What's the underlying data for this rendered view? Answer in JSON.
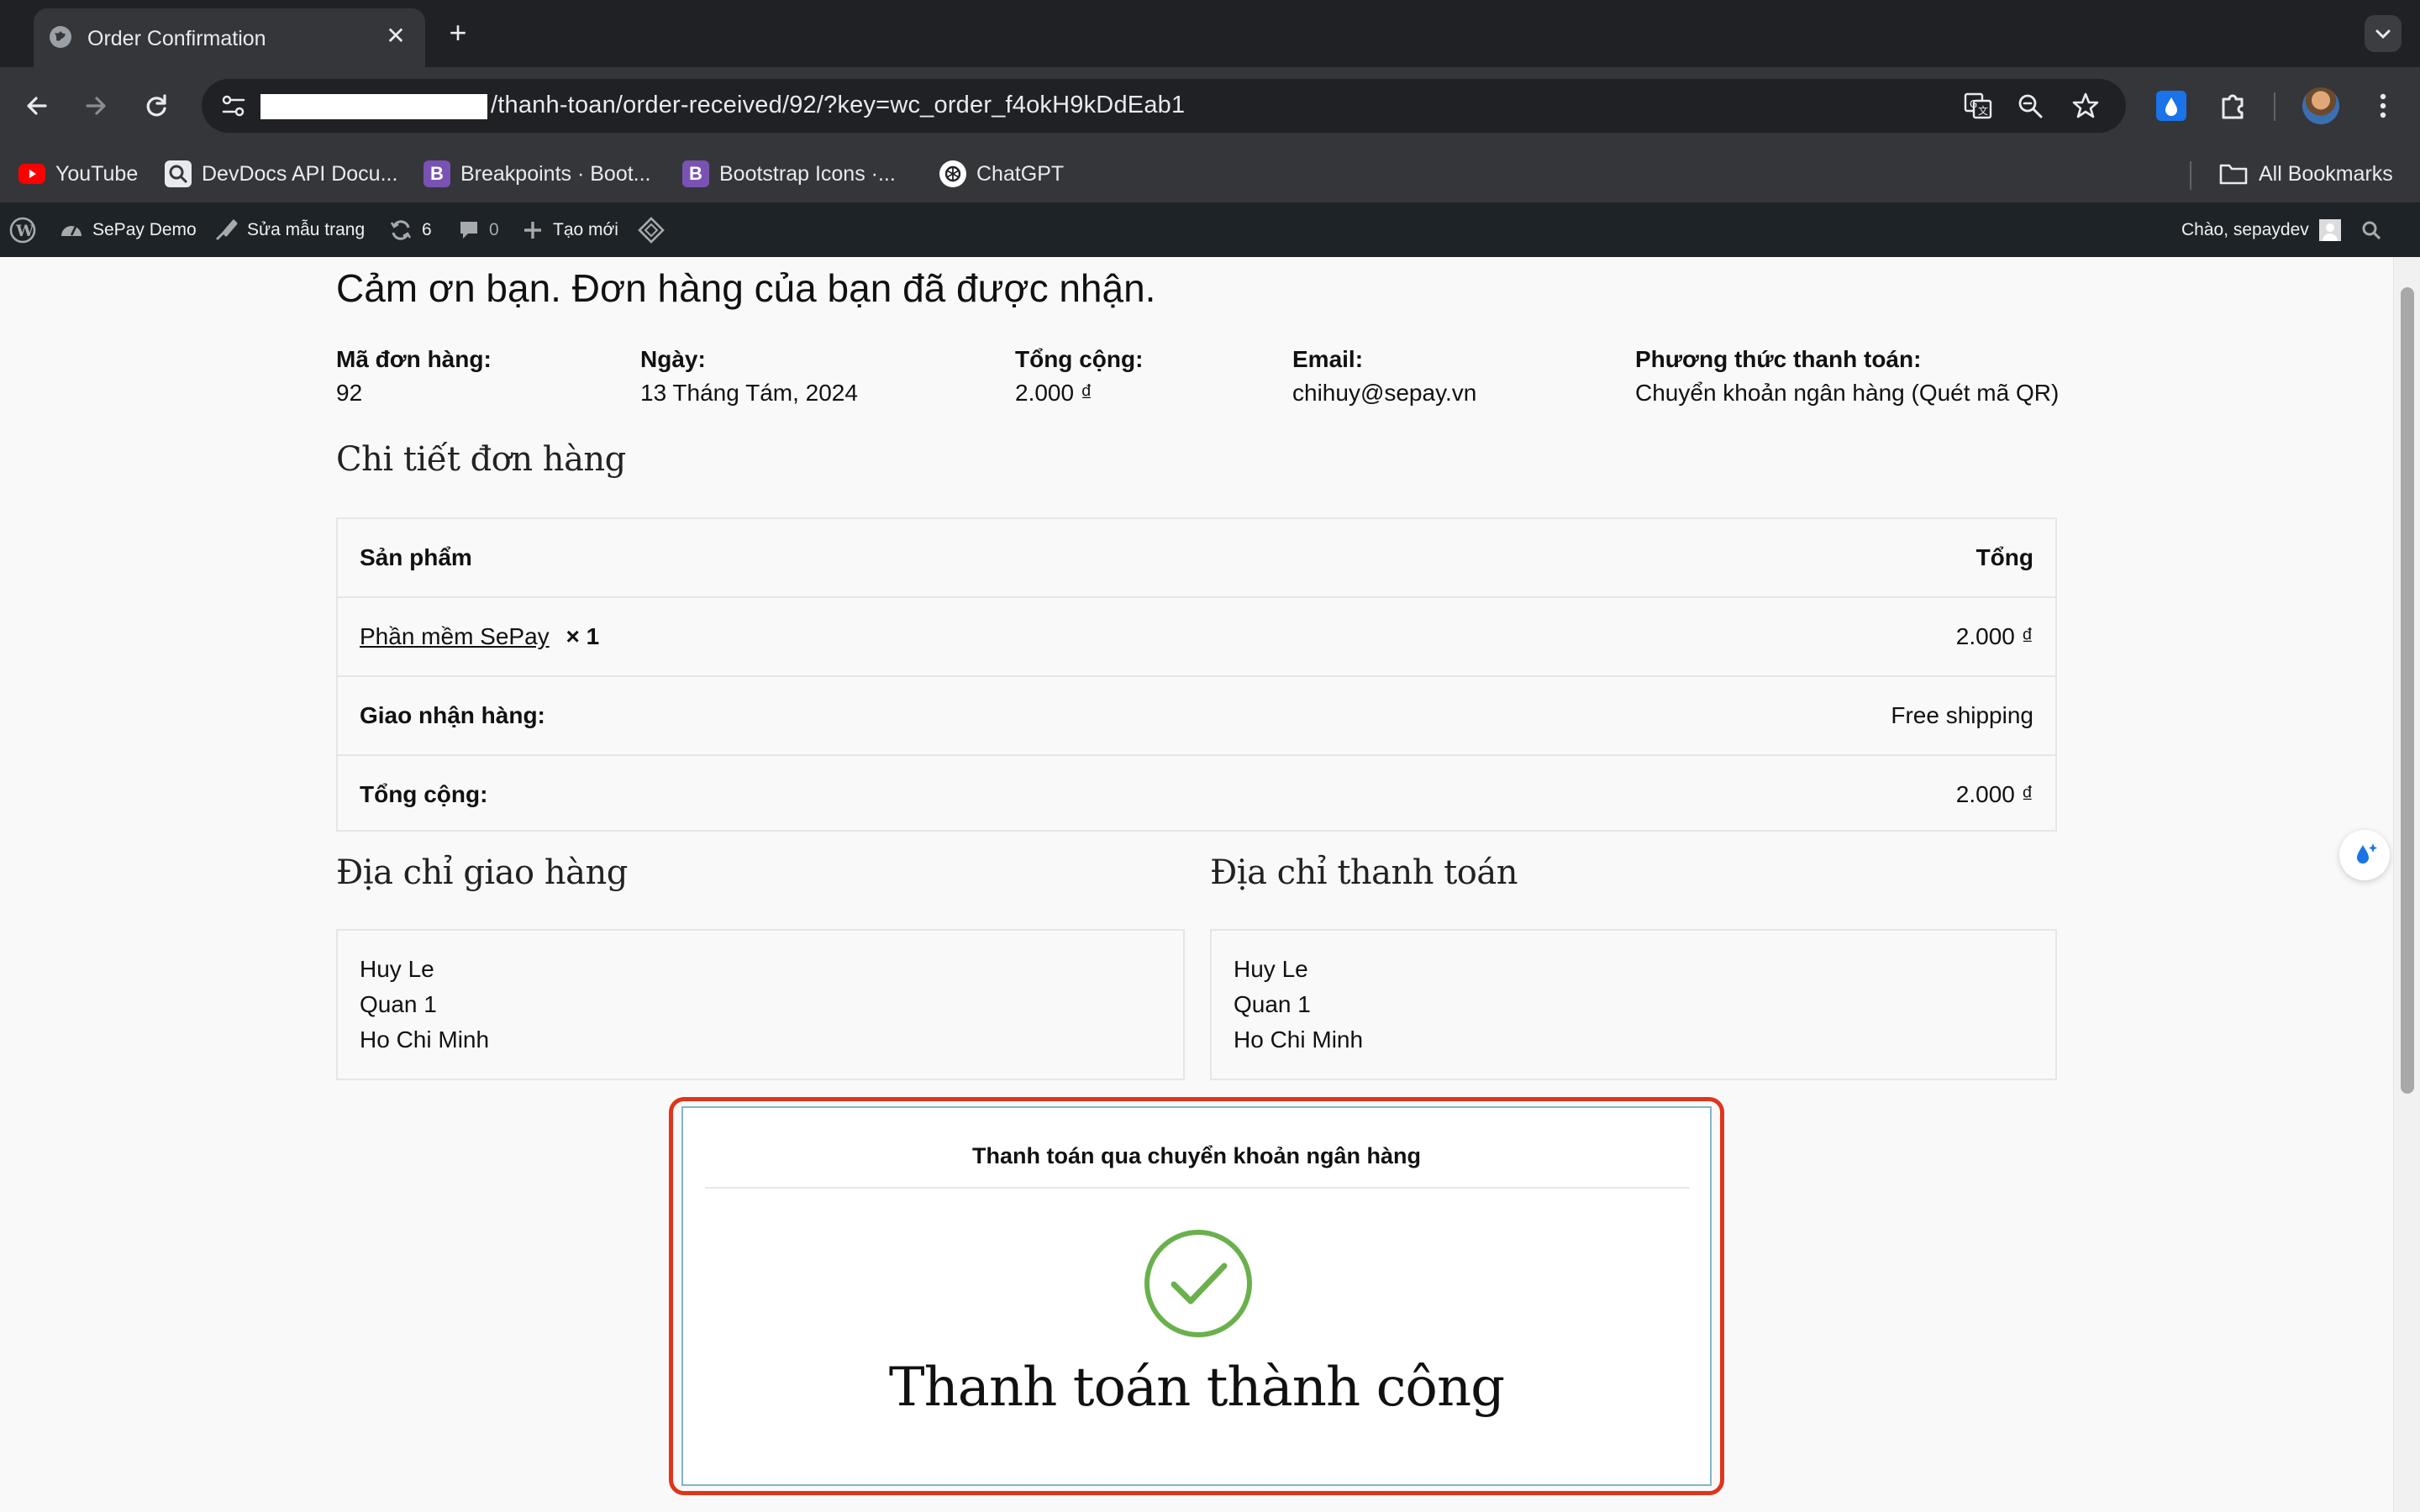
{
  "browser": {
    "tab_title": "Order Confirmation",
    "url_path": "/thanh-toan/order-received/92/?key=wc_order_f4okH9kDdEab1",
    "bookmarks": [
      {
        "label": "YouTube",
        "icon": "youtube-icon"
      },
      {
        "label": "DevDocs API Docu...",
        "icon": "devdocs-icon"
      },
      {
        "label": "Breakpoints · Boot...",
        "icon": "bootstrap-icon"
      },
      {
        "label": "Bootstrap Icons ·...",
        "icon": "bootstrap-icon"
      },
      {
        "label": "ChatGPT",
        "icon": "chatgpt-icon"
      }
    ],
    "all_bookmarks": "All Bookmarks"
  },
  "wpbar": {
    "site_name": "SePay Demo",
    "edit_template": "Sửa mẫu trang",
    "updates_count": "6",
    "comments_count": "0",
    "new_label": "Tạo mới",
    "greeting": "Chào, sepaydev"
  },
  "page": {
    "thanks": "Cảm ơn bạn. Đơn hàng của bạn đã được nhận.",
    "overview": [
      {
        "label": "Mã đơn hàng:",
        "value": "92"
      },
      {
        "label": "Ngày:",
        "value": "13 Tháng Tám, 2024"
      },
      {
        "label": "Tổng cộng:",
        "value": "2.000 ₫"
      },
      {
        "label": "Email:",
        "value": "chihuy@sepay.vn"
      },
      {
        "label": "Phương thức thanh toán:",
        "value": "Chuyển khoản ngân hàng (Quét mã QR)"
      }
    ],
    "order_details_heading": "Chi tiết đơn hàng",
    "table": {
      "col_product": "Sản phẩm",
      "col_total": "Tổng",
      "product_name": "Phần mềm SePay",
      "product_qty": "× 1",
      "product_total": "2.000 ₫",
      "shipping_label": "Giao nhận hàng:",
      "shipping_value": "Free shipping",
      "total_label": "Tổng cộng:",
      "total_value": "2.000 ₫"
    },
    "shipping_address_heading": "Địa chỉ giao hàng",
    "billing_address_heading": "Địa chỉ thanh toán",
    "shipping_address": [
      "Huy Le",
      "Quan 1",
      "Ho Chi Minh"
    ],
    "billing_address": [
      "Huy Le",
      "Quan 1",
      "Ho Chi Minh"
    ],
    "payment_box": {
      "title": "Thanh toán qua chuyển khoản ngân hàng",
      "status": "Thanh toán thành công"
    }
  },
  "colors": {
    "highlight_border": "#e0351b",
    "success_green": "#6ab04c",
    "wpbar_bg": "#1d2327"
  }
}
